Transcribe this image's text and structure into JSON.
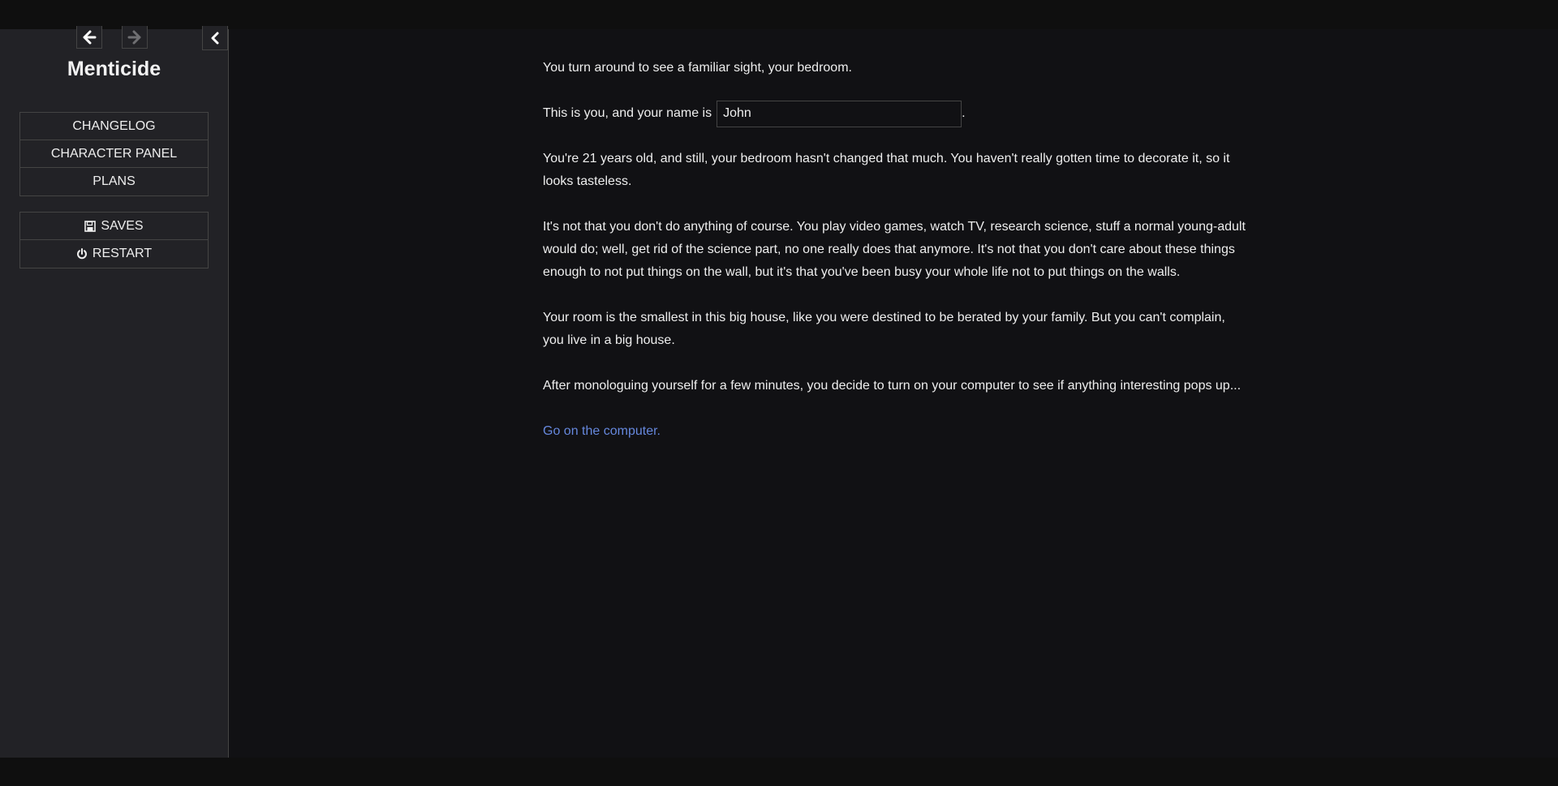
{
  "sidebar": {
    "title": "Menticide",
    "history": {
      "back_icon": "arrow-left-icon",
      "forward_icon": "arrow-right-icon"
    },
    "toggle_icon": "chevron-left-icon",
    "story_menu": [
      {
        "label": "CHANGELOG"
      },
      {
        "label": "CHARACTER PANEL"
      },
      {
        "label": "PLANS"
      }
    ],
    "core_menu": [
      {
        "label": "SAVES",
        "icon": "floppy-disk-icon"
      },
      {
        "label": "RESTART",
        "icon": "power-icon"
      }
    ]
  },
  "passage": {
    "p1": "You turn around to see a familiar sight, your bedroom.",
    "name_prefix": "This is you, and your name is",
    "name_value": "John",
    "name_suffix": ".",
    "p3": "You're 21 years old, and still, your bedroom hasn't changed that much. You haven't really gotten time to decorate it, so it looks tasteless.",
    "p4": "It's not that you don't do anything of course. You play video games, watch TV, research science, stuff a normal young-adult would do; well, get rid of the science part, no one really does that anymore. It's not that you don't care about these things enough to not put things on the wall, but it's that you've been busy your whole life not to put things on the walls.",
    "p5": "Your room is the smallest in this big house, like you were destined to be berated by your family. But you can't complain, you live in a big house.",
    "p6": "After monologuing yourself for a few minutes, you decide to turn on your computer to see if anything interesting pops up...",
    "link": "Go on the computer."
  },
  "colors": {
    "background": "#111114",
    "sidebar": "#222226",
    "link": "#6688dd",
    "text": "#eeeeee"
  }
}
